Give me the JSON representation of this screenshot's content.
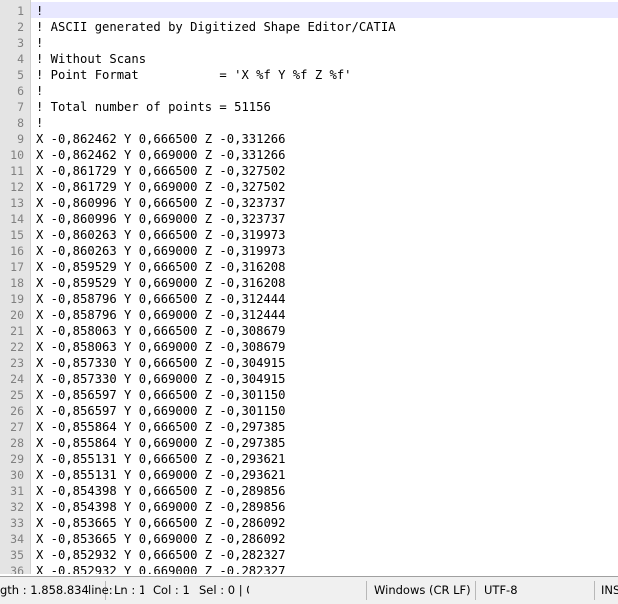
{
  "editor": {
    "current_line": 1,
    "lines": [
      {
        "n": "1",
        "text": "!"
      },
      {
        "n": "2",
        "text": "! ASCII generated by Digitized Shape Editor/CATIA"
      },
      {
        "n": "3",
        "text": "!"
      },
      {
        "n": "4",
        "text": "! Without Scans"
      },
      {
        "n": "5",
        "text": "! Point Format           = 'X %f Y %f Z %f'"
      },
      {
        "n": "6",
        "text": "!"
      },
      {
        "n": "7",
        "text": "! Total number of points = 51156"
      },
      {
        "n": "8",
        "text": "!"
      },
      {
        "n": "9",
        "text": "X -0,862462 Y 0,666500 Z -0,331266"
      },
      {
        "n": "10",
        "text": "X -0,862462 Y 0,669000 Z -0,331266"
      },
      {
        "n": "11",
        "text": "X -0,861729 Y 0,666500 Z -0,327502"
      },
      {
        "n": "12",
        "text": "X -0,861729 Y 0,669000 Z -0,327502"
      },
      {
        "n": "13",
        "text": "X -0,860996 Y 0,666500 Z -0,323737"
      },
      {
        "n": "14",
        "text": "X -0,860996 Y 0,669000 Z -0,323737"
      },
      {
        "n": "15",
        "text": "X -0,860263 Y 0,666500 Z -0,319973"
      },
      {
        "n": "16",
        "text": "X -0,860263 Y 0,669000 Z -0,319973"
      },
      {
        "n": "17",
        "text": "X -0,859529 Y 0,666500 Z -0,316208"
      },
      {
        "n": "18",
        "text": "X -0,859529 Y 0,669000 Z -0,316208"
      },
      {
        "n": "19",
        "text": "X -0,858796 Y 0,666500 Z -0,312444"
      },
      {
        "n": "20",
        "text": "X -0,858796 Y 0,669000 Z -0,312444"
      },
      {
        "n": "21",
        "text": "X -0,858063 Y 0,666500 Z -0,308679"
      },
      {
        "n": "22",
        "text": "X -0,858063 Y 0,669000 Z -0,308679"
      },
      {
        "n": "23",
        "text": "X -0,857330 Y 0,666500 Z -0,304915"
      },
      {
        "n": "24",
        "text": "X -0,857330 Y 0,669000 Z -0,304915"
      },
      {
        "n": "25",
        "text": "X -0,856597 Y 0,666500 Z -0,301150"
      },
      {
        "n": "26",
        "text": "X -0,856597 Y 0,669000 Z -0,301150"
      },
      {
        "n": "27",
        "text": "X -0,855864 Y 0,666500 Z -0,297385"
      },
      {
        "n": "28",
        "text": "X -0,855864 Y 0,669000 Z -0,297385"
      },
      {
        "n": "29",
        "text": "X -0,855131 Y 0,666500 Z -0,293621"
      },
      {
        "n": "30",
        "text": "X -0,855131 Y 0,669000 Z -0,293621"
      },
      {
        "n": "31",
        "text": "X -0,854398 Y 0,666500 Z -0,289856"
      },
      {
        "n": "32",
        "text": "X -0,854398 Y 0,669000 Z -0,289856"
      },
      {
        "n": "33",
        "text": "X -0,853665 Y 0,666500 Z -0,286092"
      },
      {
        "n": "34",
        "text": "X -0,853665 Y 0,669000 Z -0,286092"
      },
      {
        "n": "35",
        "text": "X -0,852932 Y 0,666500 Z -0,282327"
      },
      {
        "n": "36",
        "text": "X -0,852932 Y 0,669000 Z -0,282327"
      }
    ]
  },
  "statusbar": {
    "length": "gth : 1.858.834",
    "lines": "line:",
    "ln": "Ln : 1",
    "col": "Col : 1",
    "sel": "Sel : 0 | 0",
    "eol": "Windows (CR LF)",
    "encoding": "UTF-8",
    "mode": "INS"
  }
}
